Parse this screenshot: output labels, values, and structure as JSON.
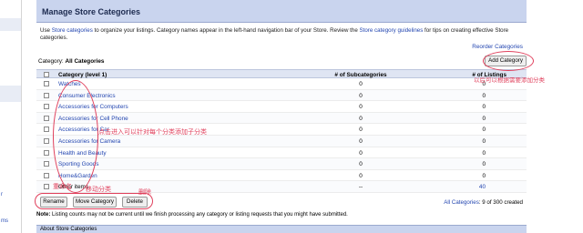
{
  "sidebar": {
    "links": [
      "r",
      "ms"
    ]
  },
  "page": {
    "title": "Manage Store Categories",
    "intro_1": "Use ",
    "intro_link_1": "Store categories",
    "intro_2": " to organize your listings. Category names appear in the left-hand navigation bar of your Store. Review the ",
    "intro_link_2": "Store category guidelines",
    "intro_3": " for tips on creating effective Store categories.",
    "reorder_label": "Reorder Categories",
    "category_prefix": "Category:",
    "category_value": "All Categories",
    "add_category_label": "Add Category"
  },
  "table": {
    "headers": {
      "name": "Category (level 1)",
      "sub": "# of Subcategories",
      "listings": "# of Listings"
    },
    "rows": [
      {
        "name": "Watches",
        "sub": "0",
        "listings": "0"
      },
      {
        "name": "Consumer Electronics",
        "sub": "0",
        "listings": "0"
      },
      {
        "name": "Accessories for Computers",
        "sub": "0",
        "listings": "0"
      },
      {
        "name": "Accessories for Cell Phone",
        "sub": "0",
        "listings": "0"
      },
      {
        "name": "Accessories for Car",
        "sub": "0",
        "listings": "0"
      },
      {
        "name": "Accessories for Camera",
        "sub": "0",
        "listings": "0"
      },
      {
        "name": "Health and Beauty",
        "sub": "0",
        "listings": "0"
      },
      {
        "name": "Sporting Goods",
        "sub": "0",
        "listings": "0"
      },
      {
        "name": "Home&Garden",
        "sub": "0",
        "listings": "0"
      },
      {
        "name": "Other items",
        "sub": "--",
        "listings": "40"
      }
    ]
  },
  "actions": {
    "rename": "Rename",
    "move": "Move Category",
    "delete": "Delete",
    "all_categories_link": "All Categories",
    "count_text": ": 9 of 300 created"
  },
  "note": {
    "label": "Note:",
    "text": " Listing counts may not be current until we finish processing any category or listing requests that you might have submitted."
  },
  "about": {
    "title": "About Store Categories"
  },
  "annotations": {
    "add_note": "以后可以根据需要添加分类",
    "row_note": "点击进入可以针对每个分类添加子分类",
    "rename_note": "重命名",
    "move_note": "移动分类",
    "delete_note": "删除"
  },
  "colors": {
    "header_bg": "#c9d4ee",
    "link": "#2346b0",
    "annotation": "#e0405c"
  }
}
